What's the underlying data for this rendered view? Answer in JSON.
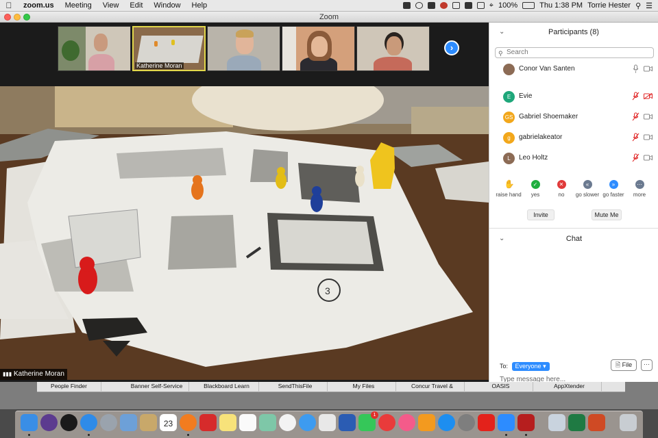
{
  "menubar": {
    "app": "zoom.us",
    "menus": [
      "Meeting",
      "View",
      "Edit",
      "Window",
      "Help"
    ],
    "battery": "100%",
    "clock": "Thu 1:38 PM",
    "user": "Torrie Hester"
  },
  "window": {
    "title": "Zoom"
  },
  "thumbnails": [
    {
      "name": ""
    },
    {
      "name": "Katherine Moran"
    },
    {
      "name": ""
    },
    {
      "name": ""
    },
    {
      "name": ""
    }
  ],
  "main_video": {
    "speaker": "Katherine Moran"
  },
  "participants": {
    "header": "Participants (8)",
    "search_placeholder": "Search",
    "list": [
      {
        "name": "Conor Van Santen",
        "initials": ""
      },
      {
        "name": "Evie",
        "initials": "E"
      },
      {
        "name": "Gabriel Shoemaker",
        "initials": "GS"
      },
      {
        "name": "gabrielakeator",
        "initials": "g"
      },
      {
        "name": "Leo Holtz",
        "initials": "L"
      }
    ],
    "reactions": [
      {
        "label": "raise hand",
        "icon": "hand-icon"
      },
      {
        "label": "yes",
        "icon": "check-icon"
      },
      {
        "label": "no",
        "icon": "x-icon"
      },
      {
        "label": "go slower",
        "icon": "rewind-icon"
      },
      {
        "label": "go faster",
        "icon": "fast-forward-icon"
      },
      {
        "label": "more",
        "icon": "more-icon"
      }
    ],
    "invite_label": "Invite",
    "mute_me_label": "Mute Me"
  },
  "chat": {
    "header": "Chat",
    "to_label": "To:",
    "to_value": "Everyone",
    "file_label": "File",
    "more_label": "···",
    "input_placeholder": "Type message here..."
  },
  "bookmarks": [
    "People Finder",
    "Banner Self-Service",
    "Blackboard Learn",
    "SendThisFile",
    "My Files",
    "Concur Travel &",
    "OASIS",
    "AppXtender"
  ],
  "dock": {
    "calendar_date": "23",
    "badge": "1"
  },
  "colors": {
    "zoom_blue": "#2d8cff",
    "active_thumb_border": "#e2d84b",
    "muted_red": "#e02828",
    "yes_green": "#1fae3f",
    "no_red": "#e03a3a"
  }
}
